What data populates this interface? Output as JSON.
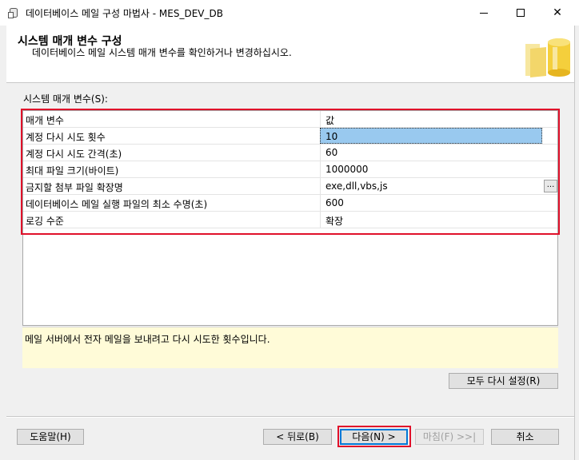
{
  "window": {
    "title": "데이터베이스 메일 구성 마법사 - MES_DEV_DB"
  },
  "header": {
    "title": "시스템 매개 변수 구성",
    "subtitle": "데이터베이스 메일 시스템 매개 변수를 확인하거나 변경하십시오."
  },
  "params": {
    "label": "시스템 매개 변수(S):",
    "columns": [
      "매개 변수",
      "값"
    ],
    "rows": [
      {
        "name": "계정 다시 시도 횟수",
        "value": "10"
      },
      {
        "name": "계정 다시 시도 간격(초)",
        "value": "60"
      },
      {
        "name": "최대 파일 크기(바이트)",
        "value": "1000000"
      },
      {
        "name": "금지할 첨부 파일 확장명",
        "value": "exe,dll,vbs,js",
        "button": "..."
      },
      {
        "name": "데이터베이스 메일 실행 파일의 최소 수명(초)",
        "value": "600"
      },
      {
        "name": "로깅 수준",
        "value": "확장"
      }
    ]
  },
  "description": "메일 서버에서 전자 메일을 보내려고 다시 시도한 횟수입니다.",
  "buttons": {
    "reset_all": "모두 다시 설정(R)",
    "help": "도움말(H)",
    "back": "< 뒤로(B)",
    "next": "다음(N) >",
    "finish": "마침(F) >>|",
    "cancel": "취소"
  },
  "colors": {
    "highlight_border": "#e0102a",
    "selected_cell": "#99c9ef",
    "description_bg": "#fffbd8"
  }
}
